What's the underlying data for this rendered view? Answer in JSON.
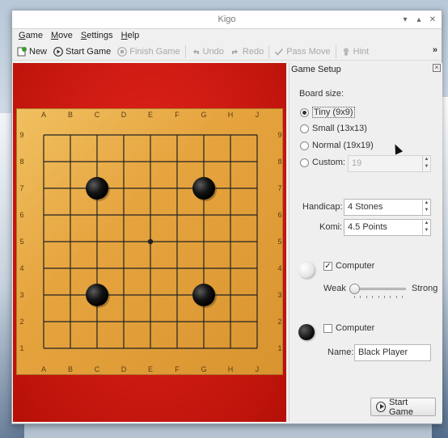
{
  "window": {
    "title": "Kigo"
  },
  "menu": [
    "Game",
    "Move",
    "Settings",
    "Help"
  ],
  "toolbar": {
    "new": "New",
    "start_game": "Start Game",
    "finish_game": "Finish Game",
    "undo": "Undo",
    "redo": "Redo",
    "pass_move": "Pass Move",
    "hint": "Hint",
    "overflow": "»"
  },
  "board": {
    "columns": [
      "A",
      "B",
      "C",
      "D",
      "E",
      "F",
      "G",
      "H",
      "J"
    ],
    "rows": [
      "9",
      "8",
      "7",
      "6",
      "5",
      "4",
      "3",
      "2",
      "1"
    ],
    "size": 9,
    "black_stones": [
      "C7",
      "G7",
      "C3",
      "G3"
    ],
    "star_point": "E5",
    "colors": {
      "board": "#e6a43f",
      "background": "#d21c13",
      "line": "#222222"
    }
  },
  "setup": {
    "title": "Game Setup",
    "close_icon": "close-icon",
    "board_size_label": "Board size:",
    "sizes": [
      {
        "label": "Tiny (9x9)",
        "selected": true
      },
      {
        "label": "Small (13x13)",
        "selected": false
      },
      {
        "label": "Normal (19x19)",
        "selected": false
      },
      {
        "label": "Custom:",
        "selected": false
      }
    ],
    "custom_value": "19",
    "handicap_label": "Handicap:",
    "handicap_value": "4 Stones",
    "komi_label": "Komi:",
    "komi_value": "4.5 Points",
    "white": {
      "computer_label": "Computer",
      "computer_checked": true,
      "strength_min": "Weak",
      "strength_max": "Strong",
      "strength_level": 0
    },
    "black": {
      "computer_label": "Computer",
      "computer_checked": false,
      "name_label": "Name:",
      "name_value": "Black Player"
    },
    "start_button": "Start Game"
  }
}
